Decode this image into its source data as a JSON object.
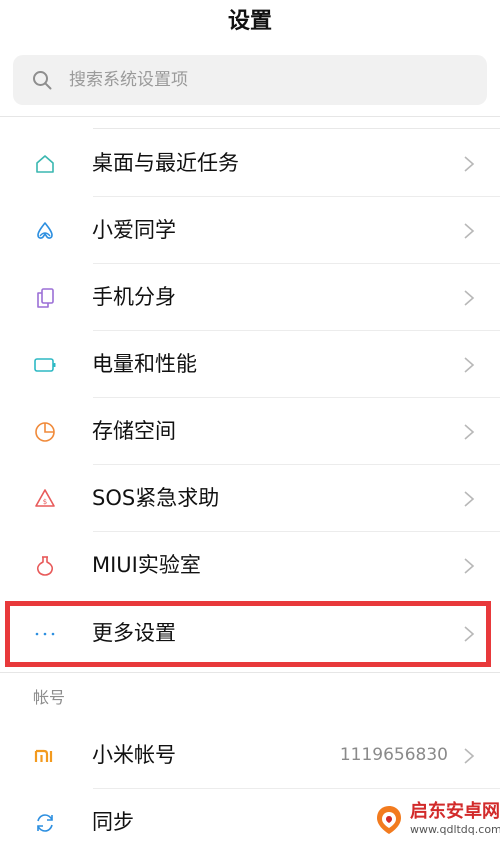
{
  "header": {
    "title": "设置"
  },
  "search": {
    "placeholder": "搜索系统设置项"
  },
  "settings": {
    "items": [
      {
        "label": "桌面与最近任务",
        "icon": "home-icon",
        "color": "#3ab7b0"
      },
      {
        "label": "小爱同学",
        "icon": "xiaoai-icon",
        "color": "#2d8fe0"
      },
      {
        "label": "手机分身",
        "icon": "clone-icon",
        "color": "#9b6fd6"
      },
      {
        "label": "电量和性能",
        "icon": "battery-icon",
        "color": "#2db9c4"
      },
      {
        "label": "存储空间",
        "icon": "pie-chart-icon",
        "color": "#f08a3a"
      },
      {
        "label": "SOS紧急求助",
        "icon": "sos-icon",
        "color": "#e85a5a"
      },
      {
        "label": "MIUI实验室",
        "icon": "flask-icon",
        "color": "#e85a5a"
      },
      {
        "label": "更多设置",
        "icon": "more-dots-icon",
        "color": "#2d8fe0"
      }
    ]
  },
  "account": {
    "section_title": "帐号",
    "items": [
      {
        "label": "小米帐号",
        "value": "1119656830",
        "icon": "mi-logo-icon",
        "color": "#f39a1e"
      },
      {
        "label": "同步",
        "icon": "sync-icon",
        "color": "#2d8fe0"
      }
    ]
  },
  "watermark": {
    "name": "启东安卓网",
    "url": "www.qdltdq.com"
  },
  "colors": {
    "highlight": "#e8393b",
    "chevron": "#b8b8b8",
    "watermark_red": "#d22a2a"
  }
}
